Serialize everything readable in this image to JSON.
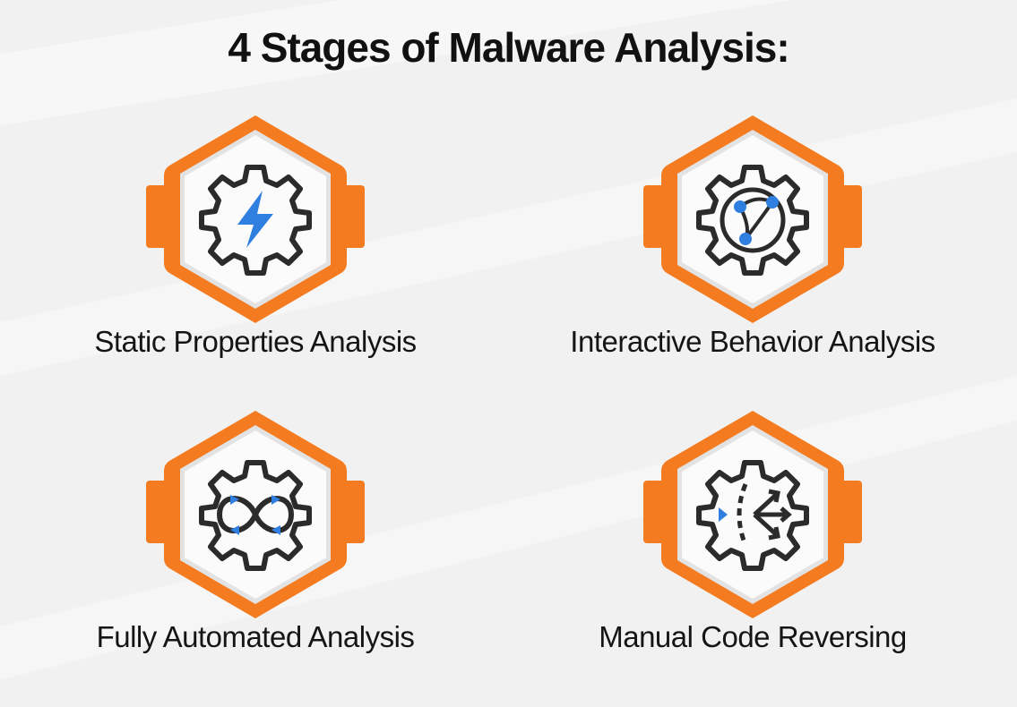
{
  "title": "4 Stages of Malware Analysis:",
  "colors": {
    "accent": "#f47b20",
    "accent_dark": "#d9650f",
    "icon_stroke": "#2b2b2b",
    "icon_highlight": "#2f7fe0",
    "background": "#f1f1f1"
  },
  "stages": [
    {
      "label": "Static Properties Analysis",
      "icon": "lightning-gear-icon"
    },
    {
      "label": "Interactive Behavior Analysis",
      "icon": "network-globe-gear-icon"
    },
    {
      "label": "Fully Automated Analysis",
      "icon": "infinity-loop-gear-icon"
    },
    {
      "label": "Manual Code Reversing",
      "icon": "branching-arrows-gear-icon"
    }
  ]
}
